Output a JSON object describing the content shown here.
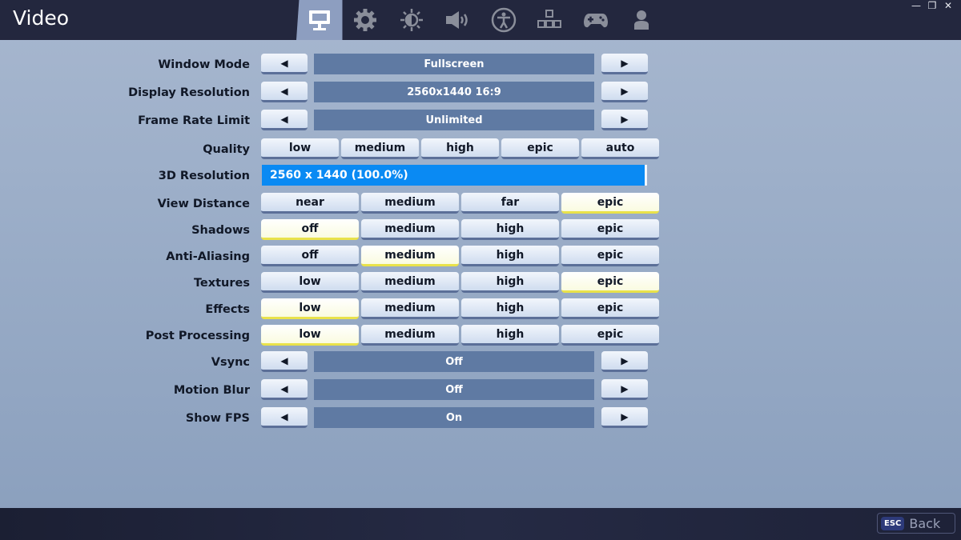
{
  "header": {
    "title": "Video",
    "tabs": [
      {
        "name": "video",
        "icon": "monitor-icon",
        "active": true
      },
      {
        "name": "game",
        "icon": "gear-icon",
        "active": false
      },
      {
        "name": "brightness",
        "icon": "brightness-icon",
        "active": false
      },
      {
        "name": "audio",
        "icon": "speaker-icon",
        "active": false
      },
      {
        "name": "accessibility",
        "icon": "accessibility-icon",
        "active": false
      },
      {
        "name": "input",
        "icon": "keyboard-arrows-icon",
        "active": false
      },
      {
        "name": "controller",
        "icon": "gamepad-icon",
        "active": false
      },
      {
        "name": "account",
        "icon": "person-icon",
        "active": false
      }
    ],
    "window_controls": {
      "minimize": "—",
      "restore": "❐",
      "close": "✕"
    }
  },
  "arrows": {
    "left": "◀",
    "right": "▶"
  },
  "settings": {
    "window_mode": {
      "label": "Window Mode",
      "value": "Fullscreen"
    },
    "display_resolution": {
      "label": "Display Resolution",
      "value": "2560x1440 16:9"
    },
    "frame_rate_limit": {
      "label": "Frame Rate Limit",
      "value": "Unlimited"
    },
    "quality": {
      "label": "Quality",
      "options": [
        "low",
        "medium",
        "high",
        "epic",
        "auto"
      ],
      "selected": null
    },
    "resolution_3d": {
      "label": "3D Resolution",
      "value": "2560 x 1440 (100.0%)",
      "percent": 100
    },
    "view_distance": {
      "label": "View Distance",
      "options": [
        "near",
        "medium",
        "far",
        "epic"
      ],
      "selected": "epic"
    },
    "shadows": {
      "label": "Shadows",
      "options": [
        "off",
        "medium",
        "high",
        "epic"
      ],
      "selected": "off"
    },
    "anti_aliasing": {
      "label": "Anti-Aliasing",
      "options": [
        "off",
        "medium",
        "high",
        "epic"
      ],
      "selected": "medium"
    },
    "textures": {
      "label": "Textures",
      "options": [
        "low",
        "medium",
        "high",
        "epic"
      ],
      "selected": "epic"
    },
    "effects": {
      "label": "Effects",
      "options": [
        "low",
        "medium",
        "high",
        "epic"
      ],
      "selected": "low"
    },
    "post_processing": {
      "label": "Post Processing",
      "options": [
        "low",
        "medium",
        "high",
        "epic"
      ],
      "selected": "low"
    },
    "vsync": {
      "label": "Vsync",
      "value": "Off"
    },
    "motion_blur": {
      "label": "Motion Blur",
      "value": "Off"
    },
    "show_fps": {
      "label": "Show FPS",
      "value": "On"
    }
  },
  "footer": {
    "esc_key": "ESC",
    "back_label": "Back"
  }
}
